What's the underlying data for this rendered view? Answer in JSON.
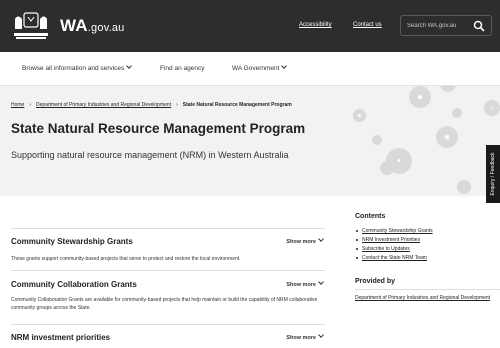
{
  "header": {
    "brand": "WA",
    "brand_suffix": ".gov.au",
    "links": [
      "Accessibility",
      "Contact us"
    ],
    "search_placeholder": "Search WA.gov.au"
  },
  "nav": {
    "items": [
      "Browse all information and services",
      "Find an agency",
      "WA Government"
    ]
  },
  "breadcrumb": {
    "home": "Home",
    "parent": "Department of Primary Industries and Regional Development",
    "current": "State Natural Resource Management Program"
  },
  "hero": {
    "title": "State Natural Resource Management Program",
    "subtitle": "Supporting natural resource management (NRM) in Western Australia"
  },
  "feedback_tab": "Enquiry / Feedback",
  "sections": [
    {
      "title": "Community Stewardship Grants",
      "show_more": "Show more",
      "description": "These grants support community-based projects that serve to protect and restore the local environment."
    },
    {
      "title": "Community Collaboration Grants",
      "show_more": "Show more",
      "description": "Community Collaboration Grants are available for community-based projects that help maintain or build the capability of NRM collaborative community groups across the State."
    },
    {
      "title": "NRM investment priorities",
      "show_more": "Show more",
      "description": ""
    }
  ],
  "contents": {
    "title": "Contents",
    "items": [
      "Community Stewardship Grants",
      "NRM Investment Priorities",
      "Subscribe to Updates",
      "Contact the State NRM Team"
    ]
  },
  "provided_by": {
    "title": "Provided by",
    "agency": "Department of Primary Industries and Regional Development"
  },
  "colors": {
    "header_bg": "#2d2d2d",
    "hero_bg": "#f2f2f2",
    "feedback_bg": "#1a1a1a"
  }
}
